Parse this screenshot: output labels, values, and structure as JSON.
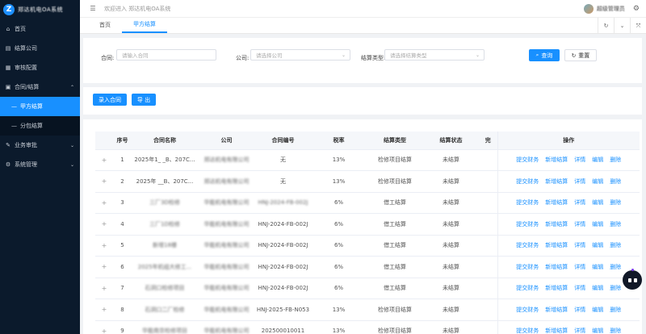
{
  "app": {
    "logo_letter": "Z",
    "logo_text": "郑达机电OA系统"
  },
  "sidebar": {
    "items": [
      {
        "label": "首页",
        "icon": "home-icon",
        "glyph": "⌂"
      },
      {
        "label": "结算公司",
        "icon": "doc-icon",
        "glyph": "▤"
      },
      {
        "label": "审核配置",
        "icon": "list-icon",
        "glyph": "▦"
      },
      {
        "label": "合同/结算",
        "icon": "contract-icon",
        "glyph": "▣",
        "expanded": true,
        "children": [
          {
            "label": "甲方结算",
            "active": true
          },
          {
            "label": "分包结算",
            "active": false
          }
        ]
      },
      {
        "label": "业务审批",
        "icon": "approve-icon",
        "glyph": "✎"
      },
      {
        "label": "系统管理",
        "icon": "gear-icon",
        "glyph": "⚙"
      }
    ]
  },
  "header": {
    "welcome": "欢迎进入 郑达机电OA系统",
    "username": "超级管理员"
  },
  "tabs": [
    {
      "label": "首页",
      "active": false
    },
    {
      "label": "甲方结算",
      "active": true
    }
  ],
  "search": {
    "contract_label": "合同:",
    "contract_placeholder": "请输入合同",
    "company_label": "公司:",
    "company_placeholder": "请选择公司",
    "type_label": "结算类型:",
    "type_placeholder": "请选择结算类型",
    "query_label": "查询",
    "reset_label": "重置"
  },
  "actions": {
    "import_label": "录入合同",
    "export_label": "导 出"
  },
  "table": {
    "headers": [
      "",
      "序号",
      "合同名称",
      "公司",
      "合同编号",
      "税率",
      "结算类型",
      "结算状态",
      "完",
      "操作"
    ],
    "ops": [
      "提交财务",
      "新增结算",
      "详情",
      "编辑",
      "删除"
    ],
    "rows": [
      {
        "idx": "1",
        "name": "2025年1_ _B、207C...",
        "company": "郑达机电有限公司",
        "code": "无",
        "tax": "13%",
        "type": "检修项目结算",
        "status": "未结算",
        "name_blur": false,
        "company_blur": true,
        "code_blur": false
      },
      {
        "idx": "2",
        "name": "2025年 __B、207C...",
        "company": "郑达机电有限公司",
        "code": "无",
        "tax": "13%",
        "type": "检修项目结算",
        "status": "未结算",
        "name_blur": false,
        "company_blur": true,
        "code_blur": false
      },
      {
        "idx": "3",
        "name": "三厂3D检修",
        "company": "华能机电有限公司",
        "code": "HNJ-2024-FB-002J",
        "tax": "6%",
        "type": "借工结算",
        "status": "未结算",
        "name_blur": true,
        "company_blur": true,
        "code_blur": true
      },
      {
        "idx": "4",
        "name": "三厂1D检修",
        "company": "华能机电有限公司",
        "code": "HNJ-2024-FB-002J",
        "tax": "6%",
        "type": "借工结算",
        "status": "未结算",
        "name_blur": true,
        "company_blur": true,
        "code_blur": false
      },
      {
        "idx": "5",
        "name": "新增18楼",
        "company": "华能机电有限公司",
        "code": "HNJ-2024-FB-002J",
        "tax": "6%",
        "type": "借工结算",
        "status": "未结算",
        "name_blur": true,
        "company_blur": true,
        "code_blur": false
      },
      {
        "idx": "6",
        "name": "2025年机组大修工...",
        "company": "华能机电有限公司",
        "code": "HNJ-2024-FB-002J",
        "tax": "6%",
        "type": "借工结算",
        "status": "未结算",
        "name_blur": true,
        "company_blur": true,
        "code_blur": false
      },
      {
        "idx": "7",
        "name": "石洞口检修项目",
        "company": "华能机电有限公司",
        "code": "HNJ-2024-FB-002J",
        "tax": "6%",
        "type": "借工结算",
        "status": "未结算",
        "name_blur": true,
        "company_blur": true,
        "code_blur": false
      },
      {
        "idx": "8",
        "name": "石洞口二厂检修",
        "company": "华能机电有限公司",
        "code": "HNJ-2025-FB-N053",
        "tax": "13%",
        "type": "检修项目结算",
        "status": "未结算",
        "name_blur": true,
        "company_blur": true,
        "code_blur": false
      },
      {
        "idx": "9",
        "name": "华能南京检修项目",
        "company": "华能机电有限公司",
        "code": "202500010011",
        "tax": "13%",
        "type": "检修项目结算",
        "status": "未结算",
        "name_blur": true,
        "company_blur": true,
        "code_blur": false
      }
    ]
  },
  "colors": {
    "primary": "#1890ff",
    "sidebar_bg": "#0b1a2c",
    "sidebar_active": "#1890ff"
  }
}
